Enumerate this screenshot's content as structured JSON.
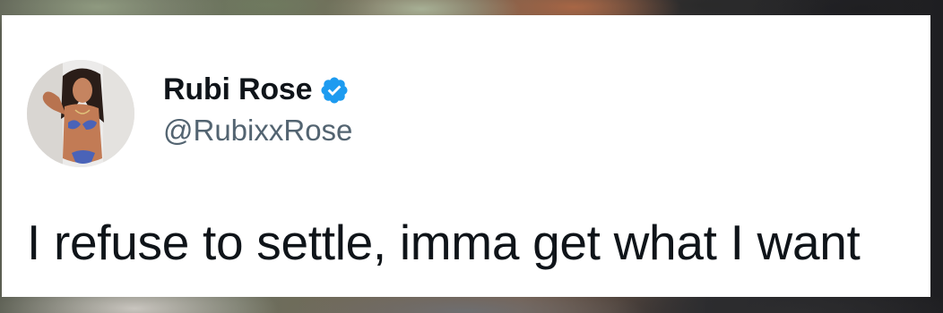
{
  "tweet": {
    "display_name": "Rubi Rose",
    "handle": "@RubixxRose",
    "text": "I refuse to settle, imma get what I want",
    "verified": true,
    "verified_color": "#1d9bf0"
  },
  "icons": {
    "verified": "verified-badge-icon",
    "avatar": "profile-photo"
  }
}
